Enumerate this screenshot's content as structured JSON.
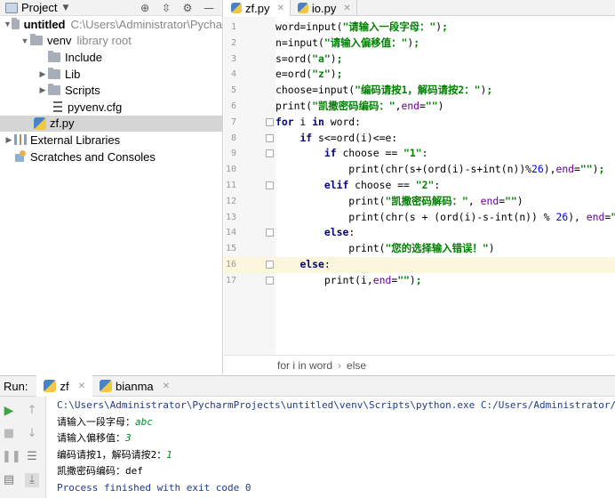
{
  "project_panel": {
    "title": "Project",
    "tree": [
      {
        "label": "untitled",
        "suffix": "C:\\Users\\Administrator\\Pycha"
      },
      {
        "label": "venv",
        "suffix": "library root"
      },
      {
        "label": "Include"
      },
      {
        "label": "Lib"
      },
      {
        "label": "Scripts"
      },
      {
        "label": "pyvenv.cfg"
      },
      {
        "label": "zf.py"
      },
      {
        "label": "External Libraries"
      },
      {
        "label": "Scratches and Consoles"
      }
    ]
  },
  "editor": {
    "tabs": [
      {
        "label": "zf.py",
        "active": true
      },
      {
        "label": "io.py",
        "active": false
      }
    ],
    "current_line": 16,
    "line_numbers": [
      "1",
      "2",
      "3",
      "4",
      "5",
      "6",
      "7",
      "8",
      "9",
      "10",
      "11",
      "12",
      "13",
      "14",
      "15",
      "16",
      "17"
    ],
    "lines": [
      {
        "indent": "",
        "tokens": [
          {
            "t": "word=input("
          },
          {
            "t": "\"请输入一段字母：\"",
            "c": "str"
          },
          {
            "t": ")"
          },
          {
            "t": ";",
            "c": "str"
          }
        ]
      },
      {
        "indent": "",
        "tokens": [
          {
            "t": "n=input("
          },
          {
            "t": "\"请输入偏移值：\"",
            "c": "str"
          },
          {
            "t": ")"
          },
          {
            "t": ";",
            "c": "str"
          }
        ]
      },
      {
        "indent": "",
        "tokens": [
          {
            "t": "s=ord("
          },
          {
            "t": "\"a\"",
            "c": "str"
          },
          {
            "t": ")"
          },
          {
            "t": ";",
            "c": "str"
          }
        ]
      },
      {
        "indent": "",
        "tokens": [
          {
            "t": "e=ord("
          },
          {
            "t": "\"z\"",
            "c": "str"
          },
          {
            "t": ")"
          },
          {
            "t": ";",
            "c": "str"
          }
        ]
      },
      {
        "indent": "",
        "tokens": [
          {
            "t": "choose=input("
          },
          {
            "t": "\"编码请按1，解码请按2：\"",
            "c": "str"
          },
          {
            "t": ")"
          },
          {
            "t": ";",
            "c": "str"
          }
        ]
      },
      {
        "indent": "",
        "tokens": [
          {
            "t": "print("
          },
          {
            "t": "\"凯撒密码编码：\"",
            "c": "str"
          },
          {
            "t": ","
          },
          {
            "t": "end",
            "c": "kwarg"
          },
          {
            "t": "="
          },
          {
            "t": "\"\"",
            "c": "str"
          },
          {
            "t": ")"
          }
        ]
      },
      {
        "indent": "",
        "tokens": [
          {
            "t": "for",
            "c": "kw"
          },
          {
            "t": " i "
          },
          {
            "t": "in",
            "c": "kw"
          },
          {
            "t": " word:"
          }
        ]
      },
      {
        "indent": "    ",
        "tokens": [
          {
            "t": "if",
            "c": "kw"
          },
          {
            "t": " s<=ord(i)<=e:"
          }
        ]
      },
      {
        "indent": "        ",
        "tokens": [
          {
            "t": "if",
            "c": "kw"
          },
          {
            "t": " choose == "
          },
          {
            "t": "\"1\"",
            "c": "str"
          },
          {
            "t": ":"
          }
        ]
      },
      {
        "indent": "            ",
        "tokens": [
          {
            "t": "print(chr(s+(ord(i)-s+int(n))%"
          },
          {
            "t": "26",
            "c": "num"
          },
          {
            "t": "),"
          },
          {
            "t": "end",
            "c": "kwarg"
          },
          {
            "t": "="
          },
          {
            "t": "\"\"",
            "c": "str"
          },
          {
            "t": ")"
          },
          {
            "t": ";",
            "c": "str"
          }
        ]
      },
      {
        "indent": "        ",
        "tokens": [
          {
            "t": "elif",
            "c": "kw"
          },
          {
            "t": " choose == "
          },
          {
            "t": "\"2\"",
            "c": "str"
          },
          {
            "t": ":"
          }
        ]
      },
      {
        "indent": "            ",
        "tokens": [
          {
            "t": "print("
          },
          {
            "t": "\"凯撒密码解码：\"",
            "c": "str"
          },
          {
            "t": ", "
          },
          {
            "t": "end",
            "c": "kwarg"
          },
          {
            "t": "="
          },
          {
            "t": "\"\"",
            "c": "str"
          },
          {
            "t": ")"
          }
        ]
      },
      {
        "indent": "            ",
        "tokens": [
          {
            "t": "print(chr(s + (ord(i)-s-int(n)) % "
          },
          {
            "t": "26",
            "c": "num"
          },
          {
            "t": "), "
          },
          {
            "t": "end",
            "c": "kwarg"
          },
          {
            "t": "="
          },
          {
            "t": "\"\"",
            "c": "str"
          },
          {
            "t": ")"
          },
          {
            "t": ";",
            "c": "str"
          }
        ]
      },
      {
        "indent": "        ",
        "tokens": [
          {
            "t": "else",
            "c": "kw"
          },
          {
            "t": ":"
          }
        ]
      },
      {
        "indent": "            ",
        "tokens": [
          {
            "t": "print("
          },
          {
            "t": "\"您的选择输入错误！\"",
            "c": "str"
          },
          {
            "t": ")"
          }
        ]
      },
      {
        "indent": "    ",
        "tokens": [
          {
            "t": "else",
            "c": "kw"
          },
          {
            "t": ":"
          }
        ]
      },
      {
        "indent": "        ",
        "tokens": [
          {
            "t": "print(i,"
          },
          {
            "t": "end",
            "c": "kwarg"
          },
          {
            "t": "="
          },
          {
            "t": "\"\"",
            "c": "str"
          },
          {
            "t": ")"
          },
          {
            "t": ";",
            "c": "str"
          }
        ]
      }
    ],
    "breadcrumb": [
      "for i in word",
      "else"
    ]
  },
  "run_panel": {
    "label": "Run:",
    "tabs": [
      {
        "label": "zf",
        "active": true
      },
      {
        "label": "bianma",
        "active": false
      }
    ],
    "console": [
      {
        "type": "path",
        "text": "C:\\Users\\Administrator\\PycharmProjects\\untitled\\venv\\Scripts\\python.exe C:/Users/Administrator/Pycharm"
      },
      {
        "type": "prompt",
        "text": "请输入一段字母：",
        "input": "abc"
      },
      {
        "type": "prompt",
        "text": "请输入偏移值：",
        "input": "3"
      },
      {
        "type": "prompt",
        "text": "编码请按1，解码请按2：",
        "input": "1"
      },
      {
        "type": "output",
        "text": "凯撒密码编码：def"
      },
      {
        "type": "exit",
        "text": "Process finished with exit code 0"
      }
    ]
  }
}
